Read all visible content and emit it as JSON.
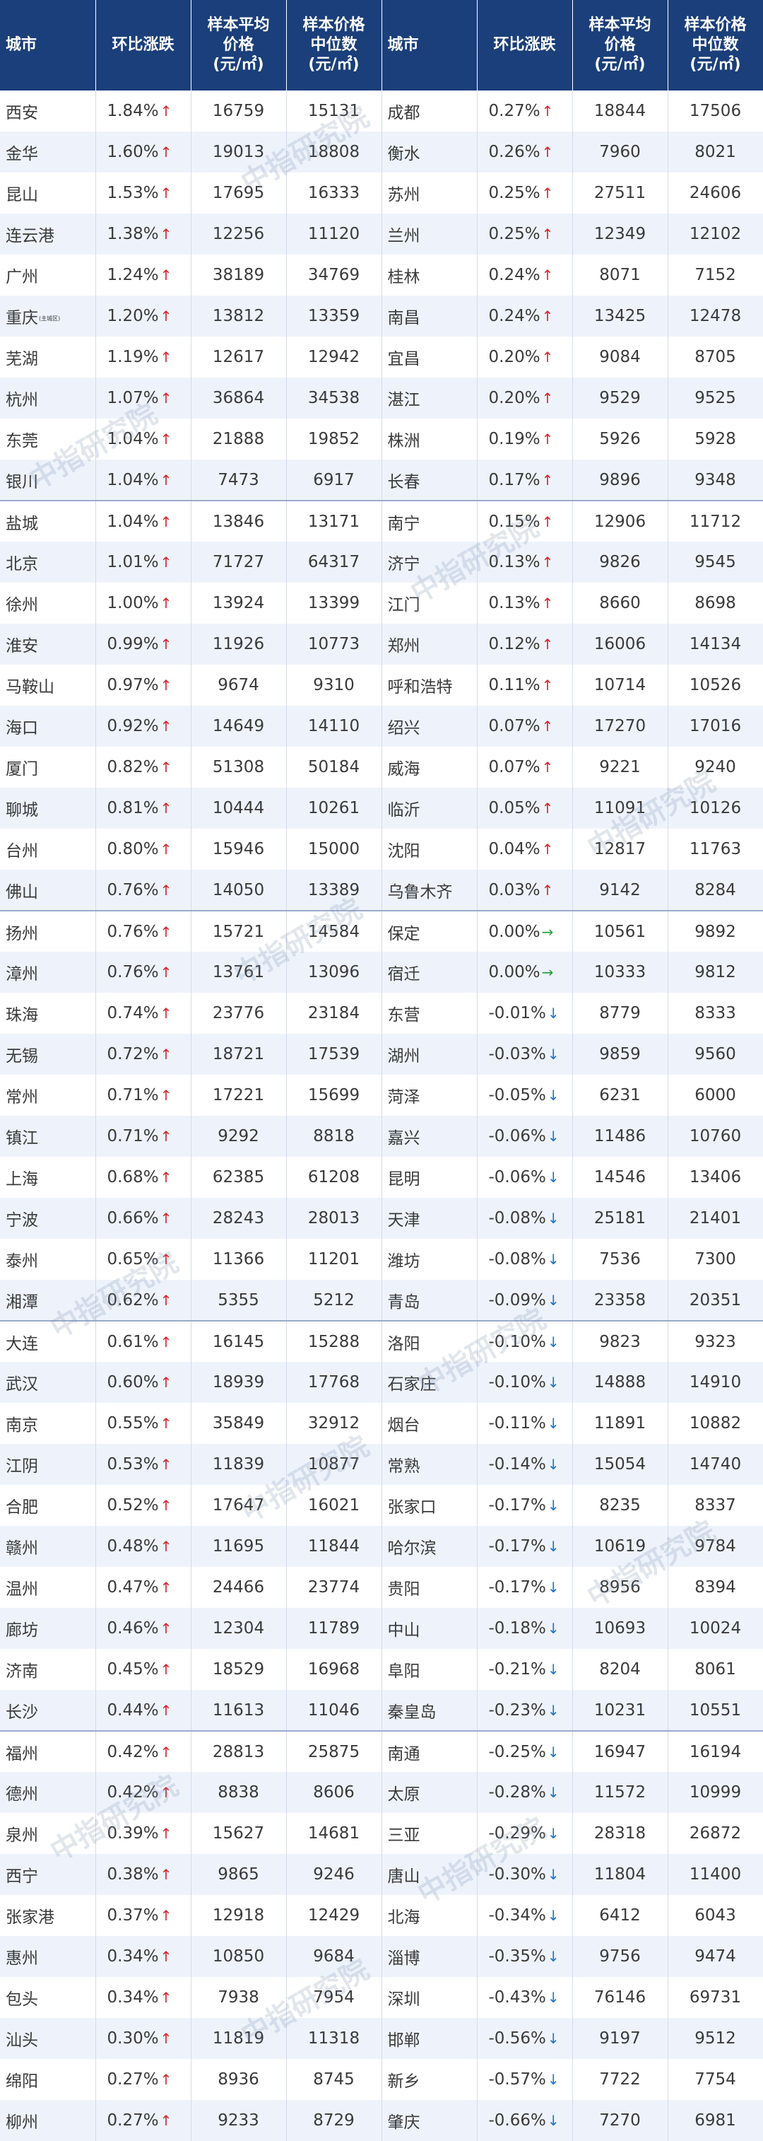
{
  "header": {
    "city": "城市",
    "change": "环比涨跌",
    "avg_line1": "样本平均",
    "avg_line2": "价格",
    "med_line1": "样本价格",
    "med_line2": "中位数",
    "unit": "(元/㎡)"
  },
  "watermark": "中指研究院",
  "arrows": {
    "up": "↑",
    "down": "↓",
    "flat": "→"
  },
  "colors": {
    "header_bg": "#1b3f7a",
    "up": "#d9242a",
    "down": "#1f74c8",
    "flat": "#20a33a",
    "row_alt": "#eef3fb"
  },
  "rows": [
    {
      "l": {
        "city": "西安",
        "sub": "",
        "change": "1.84%",
        "dir": "up",
        "avg": "16759",
        "median": "15131"
      },
      "r": {
        "city": "成都",
        "sub": "",
        "change": "0.27%",
        "dir": "up",
        "avg": "18844",
        "median": "17506"
      }
    },
    {
      "l": {
        "city": "金华",
        "sub": "",
        "change": "1.60%",
        "dir": "up",
        "avg": "19013",
        "median": "18808"
      },
      "r": {
        "city": "衡水",
        "sub": "",
        "change": "0.26%",
        "dir": "up",
        "avg": "7960",
        "median": "8021"
      }
    },
    {
      "l": {
        "city": "昆山",
        "sub": "",
        "change": "1.53%",
        "dir": "up",
        "avg": "17695",
        "median": "16333"
      },
      "r": {
        "city": "苏州",
        "sub": "",
        "change": "0.25%",
        "dir": "up",
        "avg": "27511",
        "median": "24606"
      }
    },
    {
      "l": {
        "city": "连云港",
        "sub": "",
        "change": "1.38%",
        "dir": "up",
        "avg": "12256",
        "median": "11120"
      },
      "r": {
        "city": "兰州",
        "sub": "",
        "change": "0.25%",
        "dir": "up",
        "avg": "12349",
        "median": "12102"
      }
    },
    {
      "l": {
        "city": "广州",
        "sub": "",
        "change": "1.24%",
        "dir": "up",
        "avg": "38189",
        "median": "34769"
      },
      "r": {
        "city": "桂林",
        "sub": "",
        "change": "0.24%",
        "dir": "up",
        "avg": "8071",
        "median": "7152"
      }
    },
    {
      "l": {
        "city": "重庆",
        "sub": "(主城区)",
        "change": "1.20%",
        "dir": "up",
        "avg": "13812",
        "median": "13359"
      },
      "r": {
        "city": "南昌",
        "sub": "",
        "change": "0.24%",
        "dir": "up",
        "avg": "13425",
        "median": "12478"
      }
    },
    {
      "l": {
        "city": "芜湖",
        "sub": "",
        "change": "1.19%",
        "dir": "up",
        "avg": "12617",
        "median": "12942"
      },
      "r": {
        "city": "宜昌",
        "sub": "",
        "change": "0.20%",
        "dir": "up",
        "avg": "9084",
        "median": "8705"
      }
    },
    {
      "l": {
        "city": "杭州",
        "sub": "",
        "change": "1.07%",
        "dir": "up",
        "avg": "36864",
        "median": "34538"
      },
      "r": {
        "city": "湛江",
        "sub": "",
        "change": "0.20%",
        "dir": "up",
        "avg": "9529",
        "median": "9525"
      }
    },
    {
      "l": {
        "city": "东莞",
        "sub": "",
        "change": "1.04%",
        "dir": "up",
        "avg": "21888",
        "median": "19852"
      },
      "r": {
        "city": "株洲",
        "sub": "",
        "change": "0.19%",
        "dir": "up",
        "avg": "5926",
        "median": "5928"
      }
    },
    {
      "l": {
        "city": "银川",
        "sub": "",
        "change": "1.04%",
        "dir": "up",
        "avg": "7473",
        "median": "6917"
      },
      "r": {
        "city": "长春",
        "sub": "",
        "change": "0.17%",
        "dir": "up",
        "avg": "9896",
        "median": "9348"
      }
    },
    {
      "l": {
        "city": "盐城",
        "sub": "",
        "change": "1.04%",
        "dir": "up",
        "avg": "13846",
        "median": "13171"
      },
      "r": {
        "city": "南宁",
        "sub": "",
        "change": "0.15%",
        "dir": "up",
        "avg": "12906",
        "median": "11712"
      }
    },
    {
      "l": {
        "city": "北京",
        "sub": "",
        "change": "1.01%",
        "dir": "up",
        "avg": "71727",
        "median": "64317"
      },
      "r": {
        "city": "济宁",
        "sub": "",
        "change": "0.13%",
        "dir": "up",
        "avg": "9826",
        "median": "9545"
      }
    },
    {
      "l": {
        "city": "徐州",
        "sub": "",
        "change": "1.00%",
        "dir": "up",
        "avg": "13924",
        "median": "13399"
      },
      "r": {
        "city": "江门",
        "sub": "",
        "change": "0.13%",
        "dir": "up",
        "avg": "8660",
        "median": "8698"
      }
    },
    {
      "l": {
        "city": "淮安",
        "sub": "",
        "change": "0.99%",
        "dir": "up",
        "avg": "11926",
        "median": "10773"
      },
      "r": {
        "city": "郑州",
        "sub": "",
        "change": "0.12%",
        "dir": "up",
        "avg": "16006",
        "median": "14134"
      }
    },
    {
      "l": {
        "city": "马鞍山",
        "sub": "",
        "change": "0.97%",
        "dir": "up",
        "avg": "9674",
        "median": "9310"
      },
      "r": {
        "city": "呼和浩特",
        "sub": "",
        "change": "0.11%",
        "dir": "up",
        "avg": "10714",
        "median": "10526"
      }
    },
    {
      "l": {
        "city": "海口",
        "sub": "",
        "change": "0.92%",
        "dir": "up",
        "avg": "14649",
        "median": "14110"
      },
      "r": {
        "city": "绍兴",
        "sub": "",
        "change": "0.07%",
        "dir": "up",
        "avg": "17270",
        "median": "17016"
      }
    },
    {
      "l": {
        "city": "厦门",
        "sub": "",
        "change": "0.82%",
        "dir": "up",
        "avg": "51308",
        "median": "50184"
      },
      "r": {
        "city": "威海",
        "sub": "",
        "change": "0.07%",
        "dir": "up",
        "avg": "9221",
        "median": "9240"
      }
    },
    {
      "l": {
        "city": "聊城",
        "sub": "",
        "change": "0.81%",
        "dir": "up",
        "avg": "10444",
        "median": "10261"
      },
      "r": {
        "city": "临沂",
        "sub": "",
        "change": "0.05%",
        "dir": "up",
        "avg": "11091",
        "median": "10126"
      }
    },
    {
      "l": {
        "city": "台州",
        "sub": "",
        "change": "0.80%",
        "dir": "up",
        "avg": "15946",
        "median": "15000"
      },
      "r": {
        "city": "沈阳",
        "sub": "",
        "change": "0.04%",
        "dir": "up",
        "avg": "12817",
        "median": "11763"
      }
    },
    {
      "l": {
        "city": "佛山",
        "sub": "",
        "change": "0.76%",
        "dir": "up",
        "avg": "14050",
        "median": "13389"
      },
      "r": {
        "city": "乌鲁木齐",
        "sub": "",
        "change": "0.03%",
        "dir": "up",
        "avg": "9142",
        "median": "8284"
      }
    },
    {
      "l": {
        "city": "扬州",
        "sub": "",
        "change": "0.76%",
        "dir": "up",
        "avg": "15721",
        "median": "14584"
      },
      "r": {
        "city": "保定",
        "sub": "",
        "change": "0.00%",
        "dir": "flat",
        "avg": "10561",
        "median": "9892"
      }
    },
    {
      "l": {
        "city": "漳州",
        "sub": "",
        "change": "0.76%",
        "dir": "up",
        "avg": "13761",
        "median": "13096"
      },
      "r": {
        "city": "宿迁",
        "sub": "",
        "change": "0.00%",
        "dir": "flat",
        "avg": "10333",
        "median": "9812"
      }
    },
    {
      "l": {
        "city": "珠海",
        "sub": "",
        "change": "0.74%",
        "dir": "up",
        "avg": "23776",
        "median": "23184"
      },
      "r": {
        "city": "东营",
        "sub": "",
        "change": "-0.01%",
        "dir": "down",
        "avg": "8779",
        "median": "8333"
      }
    },
    {
      "l": {
        "city": "无锡",
        "sub": "",
        "change": "0.72%",
        "dir": "up",
        "avg": "18721",
        "median": "17539"
      },
      "r": {
        "city": "湖州",
        "sub": "",
        "change": "-0.03%",
        "dir": "down",
        "avg": "9859",
        "median": "9560"
      }
    },
    {
      "l": {
        "city": "常州",
        "sub": "",
        "change": "0.71%",
        "dir": "up",
        "avg": "17221",
        "median": "15699"
      },
      "r": {
        "city": "菏泽",
        "sub": "",
        "change": "-0.05%",
        "dir": "down",
        "avg": "6231",
        "median": "6000"
      }
    },
    {
      "l": {
        "city": "镇江",
        "sub": "",
        "change": "0.71%",
        "dir": "up",
        "avg": "9292",
        "median": "8818"
      },
      "r": {
        "city": "嘉兴",
        "sub": "",
        "change": "-0.06%",
        "dir": "down",
        "avg": "11486",
        "median": "10760"
      }
    },
    {
      "l": {
        "city": "上海",
        "sub": "",
        "change": "0.68%",
        "dir": "up",
        "avg": "62385",
        "median": "61208"
      },
      "r": {
        "city": "昆明",
        "sub": "",
        "change": "-0.06%",
        "dir": "down",
        "avg": "14546",
        "median": "13406"
      }
    },
    {
      "l": {
        "city": "宁波",
        "sub": "",
        "change": "0.66%",
        "dir": "up",
        "avg": "28243",
        "median": "28013"
      },
      "r": {
        "city": "天津",
        "sub": "",
        "change": "-0.08%",
        "dir": "down",
        "avg": "25181",
        "median": "21401"
      }
    },
    {
      "l": {
        "city": "泰州",
        "sub": "",
        "change": "0.65%",
        "dir": "up",
        "avg": "11366",
        "median": "11201"
      },
      "r": {
        "city": "潍坊",
        "sub": "",
        "change": "-0.08%",
        "dir": "down",
        "avg": "7536",
        "median": "7300"
      }
    },
    {
      "l": {
        "city": "湘潭",
        "sub": "",
        "change": "0.62%",
        "dir": "up",
        "avg": "5355",
        "median": "5212"
      },
      "r": {
        "city": "青岛",
        "sub": "",
        "change": "-0.09%",
        "dir": "down",
        "avg": "23358",
        "median": "20351"
      }
    },
    {
      "l": {
        "city": "大连",
        "sub": "",
        "change": "0.61%",
        "dir": "up",
        "avg": "16145",
        "median": "15288"
      },
      "r": {
        "city": "洛阳",
        "sub": "",
        "change": "-0.10%",
        "dir": "down",
        "avg": "9823",
        "median": "9323"
      }
    },
    {
      "l": {
        "city": "武汉",
        "sub": "",
        "change": "0.60%",
        "dir": "up",
        "avg": "18939",
        "median": "17768"
      },
      "r": {
        "city": "石家庄",
        "sub": "",
        "change": "-0.10%",
        "dir": "down",
        "avg": "14888",
        "median": "14910"
      }
    },
    {
      "l": {
        "city": "南京",
        "sub": "",
        "change": "0.55%",
        "dir": "up",
        "avg": "35849",
        "median": "32912"
      },
      "r": {
        "city": "烟台",
        "sub": "",
        "change": "-0.11%",
        "dir": "down",
        "avg": "11891",
        "median": "10882"
      }
    },
    {
      "l": {
        "city": "江阴",
        "sub": "",
        "change": "0.53%",
        "dir": "up",
        "avg": "11839",
        "median": "10877"
      },
      "r": {
        "city": "常熟",
        "sub": "",
        "change": "-0.14%",
        "dir": "down",
        "avg": "15054",
        "median": "14740"
      }
    },
    {
      "l": {
        "city": "合肥",
        "sub": "",
        "change": "0.52%",
        "dir": "up",
        "avg": "17647",
        "median": "16021"
      },
      "r": {
        "city": "张家口",
        "sub": "",
        "change": "-0.17%",
        "dir": "down",
        "avg": "8235",
        "median": "8337"
      }
    },
    {
      "l": {
        "city": "赣州",
        "sub": "",
        "change": "0.48%",
        "dir": "up",
        "avg": "11695",
        "median": "11844"
      },
      "r": {
        "city": "哈尔滨",
        "sub": "",
        "change": "-0.17%",
        "dir": "down",
        "avg": "10619",
        "median": "9784"
      }
    },
    {
      "l": {
        "city": "温州",
        "sub": "",
        "change": "0.47%",
        "dir": "up",
        "avg": "24466",
        "median": "23774"
      },
      "r": {
        "city": "贵阳",
        "sub": "",
        "change": "-0.17%",
        "dir": "down",
        "avg": "8956",
        "median": "8394"
      }
    },
    {
      "l": {
        "city": "廊坊",
        "sub": "",
        "change": "0.46%",
        "dir": "up",
        "avg": "12304",
        "median": "11789"
      },
      "r": {
        "city": "中山",
        "sub": "",
        "change": "-0.18%",
        "dir": "down",
        "avg": "10693",
        "median": "10024"
      }
    },
    {
      "l": {
        "city": "济南",
        "sub": "",
        "change": "0.45%",
        "dir": "up",
        "avg": "18529",
        "median": "16968"
      },
      "r": {
        "city": "阜阳",
        "sub": "",
        "change": "-0.21%",
        "dir": "down",
        "avg": "8204",
        "median": "8061"
      }
    },
    {
      "l": {
        "city": "长沙",
        "sub": "",
        "change": "0.44%",
        "dir": "up",
        "avg": "11613",
        "median": "11046"
      },
      "r": {
        "city": "秦皇岛",
        "sub": "",
        "change": "-0.23%",
        "dir": "down",
        "avg": "10231",
        "median": "10551"
      }
    },
    {
      "l": {
        "city": "福州",
        "sub": "",
        "change": "0.42%",
        "dir": "up",
        "avg": "28813",
        "median": "25875"
      },
      "r": {
        "city": "南通",
        "sub": "",
        "change": "-0.25%",
        "dir": "down",
        "avg": "16947",
        "median": "16194"
      }
    },
    {
      "l": {
        "city": "德州",
        "sub": "",
        "change": "0.42%",
        "dir": "up",
        "avg": "8838",
        "median": "8606"
      },
      "r": {
        "city": "太原",
        "sub": "",
        "change": "-0.28%",
        "dir": "down",
        "avg": "11572",
        "median": "10999"
      }
    },
    {
      "l": {
        "city": "泉州",
        "sub": "",
        "change": "0.39%",
        "dir": "up",
        "avg": "15627",
        "median": "14681"
      },
      "r": {
        "city": "三亚",
        "sub": "",
        "change": "-0.29%",
        "dir": "down",
        "avg": "28318",
        "median": "26872"
      }
    },
    {
      "l": {
        "city": "西宁",
        "sub": "",
        "change": "0.38%",
        "dir": "up",
        "avg": "9865",
        "median": "9246"
      },
      "r": {
        "city": "唐山",
        "sub": "",
        "change": "-0.30%",
        "dir": "down",
        "avg": "11804",
        "median": "11400"
      }
    },
    {
      "l": {
        "city": "张家港",
        "sub": "",
        "change": "0.37%",
        "dir": "up",
        "avg": "12918",
        "median": "12429"
      },
      "r": {
        "city": "北海",
        "sub": "",
        "change": "-0.34%",
        "dir": "down",
        "avg": "6412",
        "median": "6043"
      }
    },
    {
      "l": {
        "city": "惠州",
        "sub": "",
        "change": "0.34%",
        "dir": "up",
        "avg": "10850",
        "median": "9684"
      },
      "r": {
        "city": "淄博",
        "sub": "",
        "change": "-0.35%",
        "dir": "down",
        "avg": "9756",
        "median": "9474"
      }
    },
    {
      "l": {
        "city": "包头",
        "sub": "",
        "change": "0.34%",
        "dir": "up",
        "avg": "7938",
        "median": "7954"
      },
      "r": {
        "city": "深圳",
        "sub": "",
        "change": "-0.43%",
        "dir": "down",
        "avg": "76146",
        "median": "69731"
      }
    },
    {
      "l": {
        "city": "汕头",
        "sub": "",
        "change": "0.30%",
        "dir": "up",
        "avg": "11819",
        "median": "11318"
      },
      "r": {
        "city": "邯郸",
        "sub": "",
        "change": "-0.56%",
        "dir": "down",
        "avg": "9197",
        "median": "9512"
      }
    },
    {
      "l": {
        "city": "绵阳",
        "sub": "",
        "change": "0.27%",
        "dir": "up",
        "avg": "8936",
        "median": "8745"
      },
      "r": {
        "city": "新乡",
        "sub": "",
        "change": "-0.57%",
        "dir": "down",
        "avg": "7722",
        "median": "7754"
      }
    },
    {
      "l": {
        "city": "柳州",
        "sub": "",
        "change": "0.27%",
        "dir": "up",
        "avg": "9233",
        "median": "8729"
      },
      "r": {
        "city": "肇庆",
        "sub": "",
        "change": "-0.66%",
        "dir": "down",
        "avg": "7270",
        "median": "6981"
      }
    }
  ]
}
